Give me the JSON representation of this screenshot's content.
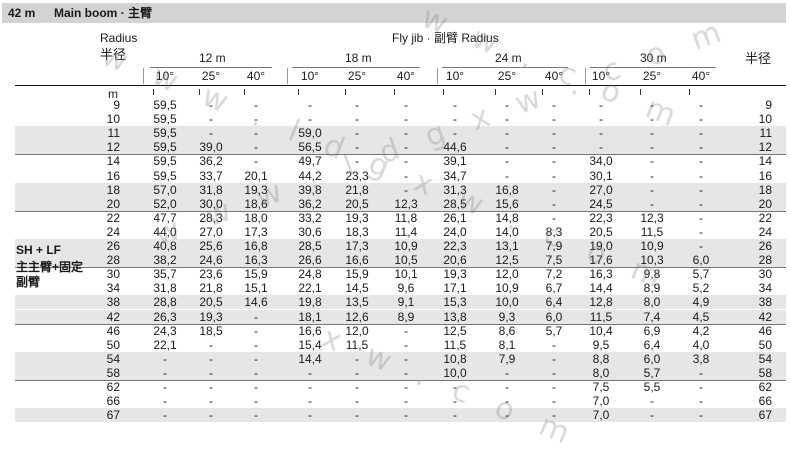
{
  "title": {
    "boom": "42 m",
    "label": "Main boom · 主臂"
  },
  "header": {
    "radius_en": "Radius",
    "radius_cn": "半径",
    "right_cn": "半径",
    "fly_jib": "Fly jib · 副臂 Radius",
    "unit": "m",
    "groups": [
      {
        "len": "12 m",
        "angles": [
          "10°",
          "25°",
          "40°"
        ]
      },
      {
        "len": "18 m",
        "angles": [
          "10°",
          "25°",
          "40°"
        ]
      },
      {
        "len": "24 m",
        "angles": [
          "10°",
          "25°",
          "40°"
        ]
      },
      {
        "len": "30 m",
        "angles": [
          "10°",
          "25°",
          "40°"
        ]
      }
    ]
  },
  "side_label": {
    "line1": "SH + LF",
    "line2": "主主臂+固定",
    "line3": "副臂"
  },
  "rows": [
    {
      "r": "9",
      "v": [
        "59,5",
        "-",
        "-",
        "-",
        "-",
        "-",
        "-",
        "-",
        "-",
        "-",
        "-",
        "-"
      ]
    },
    {
      "r": "10",
      "v": [
        "59,5",
        "-",
        "-",
        "-",
        "-",
        "-",
        "-",
        "-",
        "-",
        "-",
        "-",
        "-"
      ]
    },
    {
      "r": "11",
      "v": [
        "59,5",
        "-",
        "-",
        "59,0",
        "-",
        "-",
        "-",
        "-",
        "-",
        "-",
        "-",
        "-"
      ]
    },
    {
      "r": "12",
      "v": [
        "59,5",
        "39,0",
        "-",
        "56,5",
        "-",
        "-",
        "44,6",
        "-",
        "-",
        "-",
        "-",
        "-"
      ]
    },
    {
      "r": "14",
      "v": [
        "59,5",
        "36,2",
        "-",
        "49,7",
        "-",
        "-",
        "39,1",
        "-",
        "-",
        "34,0",
        "-",
        "-"
      ]
    },
    {
      "r": "16",
      "v": [
        "59,5",
        "33,7",
        "20,1",
        "44,2",
        "23,3",
        "-",
        "34,7",
        "-",
        "-",
        "30,1",
        "-",
        "-"
      ]
    },
    {
      "r": "18",
      "v": [
        "57,0",
        "31,8",
        "19,3",
        "39,8",
        "21,8",
        "-",
        "31,3",
        "16,8",
        "-",
        "27,0",
        "-",
        "-"
      ]
    },
    {
      "r": "20",
      "v": [
        "52,0",
        "30,0",
        "18,6",
        "36,2",
        "20,5",
        "12,3",
        "28,5",
        "15,6",
        "-",
        "24,5",
        "-",
        "-"
      ]
    },
    {
      "r": "22",
      "v": [
        "47,7",
        "28,3",
        "18,0",
        "33,2",
        "19,3",
        "11,8",
        "26,1",
        "14,8",
        "-",
        "22,3",
        "12,3",
        "-"
      ]
    },
    {
      "r": "24",
      "v": [
        "44,0",
        "27,0",
        "17,3",
        "30,6",
        "18,3",
        "11,4",
        "24,0",
        "14,0",
        "8,3",
        "20,5",
        "11,5",
        "-"
      ]
    },
    {
      "r": "26",
      "v": [
        "40,8",
        "25,6",
        "16,8",
        "28,5",
        "17,3",
        "10,9",
        "22,3",
        "13,1",
        "7,9",
        "19,0",
        "10,9",
        "-"
      ]
    },
    {
      "r": "28",
      "v": [
        "38,2",
        "24,6",
        "16,3",
        "26,6",
        "16,6",
        "10,5",
        "20,6",
        "12,5",
        "7,5",
        "17,6",
        "10,3",
        "6,0"
      ]
    },
    {
      "r": "30",
      "v": [
        "35,7",
        "23,6",
        "15,9",
        "24,8",
        "15,9",
        "10,1",
        "19,3",
        "12,0",
        "7,2",
        "16,3",
        "9,8",
        "5,7"
      ]
    },
    {
      "r": "34",
      "v": [
        "31,8",
        "21,8",
        "15,1",
        "22,1",
        "14,5",
        "9,6",
        "17,1",
        "10,9",
        "6,7",
        "14,4",
        "8,9",
        "5,2"
      ]
    },
    {
      "r": "38",
      "v": [
        "28,8",
        "20,5",
        "14,6",
        "19,8",
        "13,5",
        "9,1",
        "15,3",
        "10,0",
        "6,4",
        "12,8",
        "8,0",
        "4,9"
      ]
    },
    {
      "r": "42",
      "v": [
        "26,3",
        "19,3",
        "-",
        "18,1",
        "12,6",
        "8,9",
        "13,8",
        "9,3",
        "6,0",
        "11,5",
        "7,4",
        "4,5"
      ]
    },
    {
      "r": "46",
      "v": [
        "24,3",
        "18,5",
        "-",
        "16,6",
        "12,0",
        "-",
        "12,5",
        "8,6",
        "5,7",
        "10,4",
        "6,9",
        "4,2"
      ]
    },
    {
      "r": "50",
      "v": [
        "22,1",
        "-",
        "-",
        "15,4",
        "11,5",
        "-",
        "11,5",
        "8,1",
        "-",
        "9,5",
        "6,4",
        "4,0"
      ]
    },
    {
      "r": "54",
      "v": [
        "-",
        "-",
        "-",
        "14,4",
        "-",
        "-",
        "10,8",
        "7,9",
        "-",
        "8,8",
        "6,0",
        "3,8"
      ]
    },
    {
      "r": "58",
      "v": [
        "-",
        "-",
        "-",
        "-",
        "-",
        "-",
        "10,0",
        "-",
        "-",
        "8,0",
        "5,7",
        "-"
      ]
    },
    {
      "r": "62",
      "v": [
        "-",
        "-",
        "-",
        "-",
        "-",
        "-",
        "-",
        "-",
        "-",
        "7,5",
        "5,5",
        "-"
      ]
    },
    {
      "r": "66",
      "v": [
        "-",
        "-",
        "-",
        "-",
        "-",
        "-",
        "-",
        "-",
        "-",
        "7,0",
        "-",
        "-"
      ]
    },
    {
      "r": "67",
      "v": [
        "-",
        "-",
        "-",
        "-",
        "-",
        "-",
        "-",
        "-",
        "-",
        "7,0",
        "-",
        "-"
      ]
    }
  ]
}
